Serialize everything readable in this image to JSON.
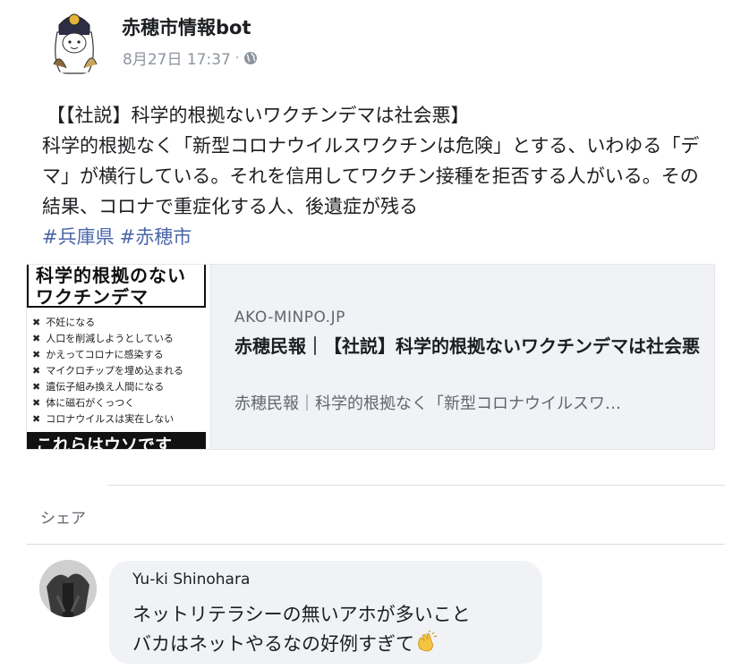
{
  "post": {
    "page_name": "赤穂市情報bot",
    "date": "8月27日 17:37",
    "separator": "·",
    "globe_icon": "globe-icon",
    "title": "【【社説】科学的根拠ないワクチンデマは社会悪】",
    "body": "科学的根拠なく「新型コロナウイルスワクチンは危険」とする、いわゆる「デマ」が横行している。それを信用してワクチン接種を拒否する人がいる。その結果、コロナで重症化する人、後遺症が残る",
    "hashtags": [
      "#兵庫県",
      "#赤穂市"
    ]
  },
  "link_card": {
    "thumbnail": {
      "headline_1": "科学的根拠のない",
      "headline_2": "ワクチンデマ",
      "items": [
        "不妊になる",
        "人口を削減しようとしている",
        "かえってコロナに感染する",
        "マイクロチップを埋め込まれる",
        "遺伝子組み換え人間になる",
        "体に磁石がくっつく",
        "コロナウイルスは実在しない"
      ],
      "banner": "これらはウソです"
    },
    "domain": "AKO-MINPO.JP",
    "title": "赤穂民報｜【社説】科学的根拠ないワクチンデマは社会悪",
    "description": "赤穂民報｜科学的根拠なく「新型コロナウイルスワ…"
  },
  "actions": {
    "share_label": "シェア"
  },
  "comment": {
    "author": "Yu-ki Shinohara",
    "line_1": "ネットリテラシーの無いアホが多いこと",
    "line_2": "バカはネットやるなの好例すぎて",
    "emoji_icon": "clapping-hands-icon"
  },
  "colors": {
    "hashtag": "#4a66a8",
    "muted": "#8d949e",
    "bubble": "#f0f2f5"
  }
}
